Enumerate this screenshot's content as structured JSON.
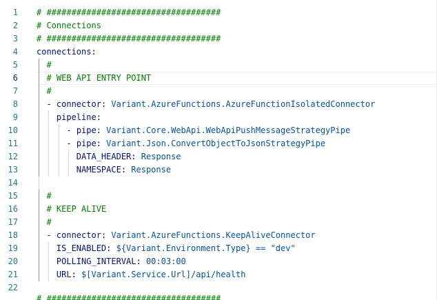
{
  "editor": {
    "active_line": 6,
    "lines": [
      {
        "n": "1",
        "indent": "",
        "tokens": [
          {
            "t": "comment",
            "v": "# ###################################"
          }
        ]
      },
      {
        "n": "2",
        "indent": "",
        "tokens": [
          {
            "t": "comment",
            "v": "# Connections"
          }
        ]
      },
      {
        "n": "3",
        "indent": "",
        "tokens": [
          {
            "t": "comment",
            "v": "# ###################################"
          }
        ]
      },
      {
        "n": "4",
        "indent": "",
        "tokens": [
          {
            "t": "key",
            "v": "connections"
          },
          {
            "t": "punct",
            "v": ":"
          }
        ]
      },
      {
        "n": "5",
        "indent": "  ",
        "tokens": [
          {
            "t": "comment",
            "v": "#"
          }
        ]
      },
      {
        "n": "6",
        "indent": "  ",
        "tokens": [
          {
            "t": "comment",
            "v": "# WEB API ENTRY POINT"
          }
        ]
      },
      {
        "n": "7",
        "indent": "  ",
        "tokens": [
          {
            "t": "comment",
            "v": "#"
          }
        ]
      },
      {
        "n": "8",
        "indent": "  ",
        "tokens": [
          {
            "t": "punct",
            "v": "- "
          },
          {
            "t": "key",
            "v": "connector"
          },
          {
            "t": "punct",
            "v": ": "
          },
          {
            "t": "str",
            "v": "Variant.AzureFunctions.AzureFunctionIsolatedConnector"
          }
        ]
      },
      {
        "n": "9",
        "indent": "    ",
        "tokens": [
          {
            "t": "key",
            "v": "pipeline"
          },
          {
            "t": "punct",
            "v": ":"
          }
        ]
      },
      {
        "n": "10",
        "indent": "      ",
        "tokens": [
          {
            "t": "punct",
            "v": "- "
          },
          {
            "t": "key",
            "v": "pipe"
          },
          {
            "t": "punct",
            "v": ": "
          },
          {
            "t": "str",
            "v": "Variant.Core.WebApi.WebApiPushMessageStrategyPipe"
          }
        ]
      },
      {
        "n": "11",
        "indent": "      ",
        "tokens": [
          {
            "t": "punct",
            "v": "- "
          },
          {
            "t": "key",
            "v": "pipe"
          },
          {
            "t": "punct",
            "v": ": "
          },
          {
            "t": "str",
            "v": "Variant.Json.ConvertObjectToJsonStrategyPipe"
          }
        ]
      },
      {
        "n": "12",
        "indent": "        ",
        "tokens": [
          {
            "t": "key",
            "v": "DATA_HEADER"
          },
          {
            "t": "punct",
            "v": ": "
          },
          {
            "t": "str",
            "v": "Response"
          }
        ]
      },
      {
        "n": "13",
        "indent": "        ",
        "tokens": [
          {
            "t": "key",
            "v": "NAMESPACE"
          },
          {
            "t": "punct",
            "v": ": "
          },
          {
            "t": "str",
            "v": "Response"
          }
        ]
      },
      {
        "n": "14",
        "indent": "",
        "tokens": []
      },
      {
        "n": "15",
        "indent": "  ",
        "tokens": [
          {
            "t": "comment",
            "v": "#"
          }
        ]
      },
      {
        "n": "16",
        "indent": "  ",
        "tokens": [
          {
            "t": "comment",
            "v": "# KEEP ALIVE"
          }
        ]
      },
      {
        "n": "17",
        "indent": "  ",
        "tokens": [
          {
            "t": "comment",
            "v": "#"
          }
        ]
      },
      {
        "n": "18",
        "indent": "  ",
        "tokens": [
          {
            "t": "punct",
            "v": "- "
          },
          {
            "t": "key",
            "v": "connector"
          },
          {
            "t": "punct",
            "v": ": "
          },
          {
            "t": "str",
            "v": "Variant.AzureFunctions.KeepAliveConnector"
          }
        ]
      },
      {
        "n": "19",
        "indent": "    ",
        "tokens": [
          {
            "t": "key",
            "v": "IS_ENABLED"
          },
          {
            "t": "punct",
            "v": ": "
          },
          {
            "t": "str",
            "v": "${Variant.Environment.Type} == \"dev\""
          }
        ]
      },
      {
        "n": "20",
        "indent": "    ",
        "tokens": [
          {
            "t": "key",
            "v": "POLLING_INTERVAL"
          },
          {
            "t": "punct",
            "v": ": "
          },
          {
            "t": "str",
            "v": "00:03:00"
          }
        ]
      },
      {
        "n": "21",
        "indent": "    ",
        "tokens": [
          {
            "t": "key",
            "v": "URL"
          },
          {
            "t": "punct",
            "v": ": "
          },
          {
            "t": "str",
            "v": "$[Variant.Service.Url]/api/health"
          }
        ]
      },
      {
        "n": "22",
        "indent": "",
        "tokens": []
      }
    ],
    "truncated_line": "# ###################################"
  },
  "colors": {
    "comment": "#008000",
    "key": "#001080",
    "string": "#0451a5",
    "line_number": "#237893",
    "active_line_number": "#0b216f"
  }
}
